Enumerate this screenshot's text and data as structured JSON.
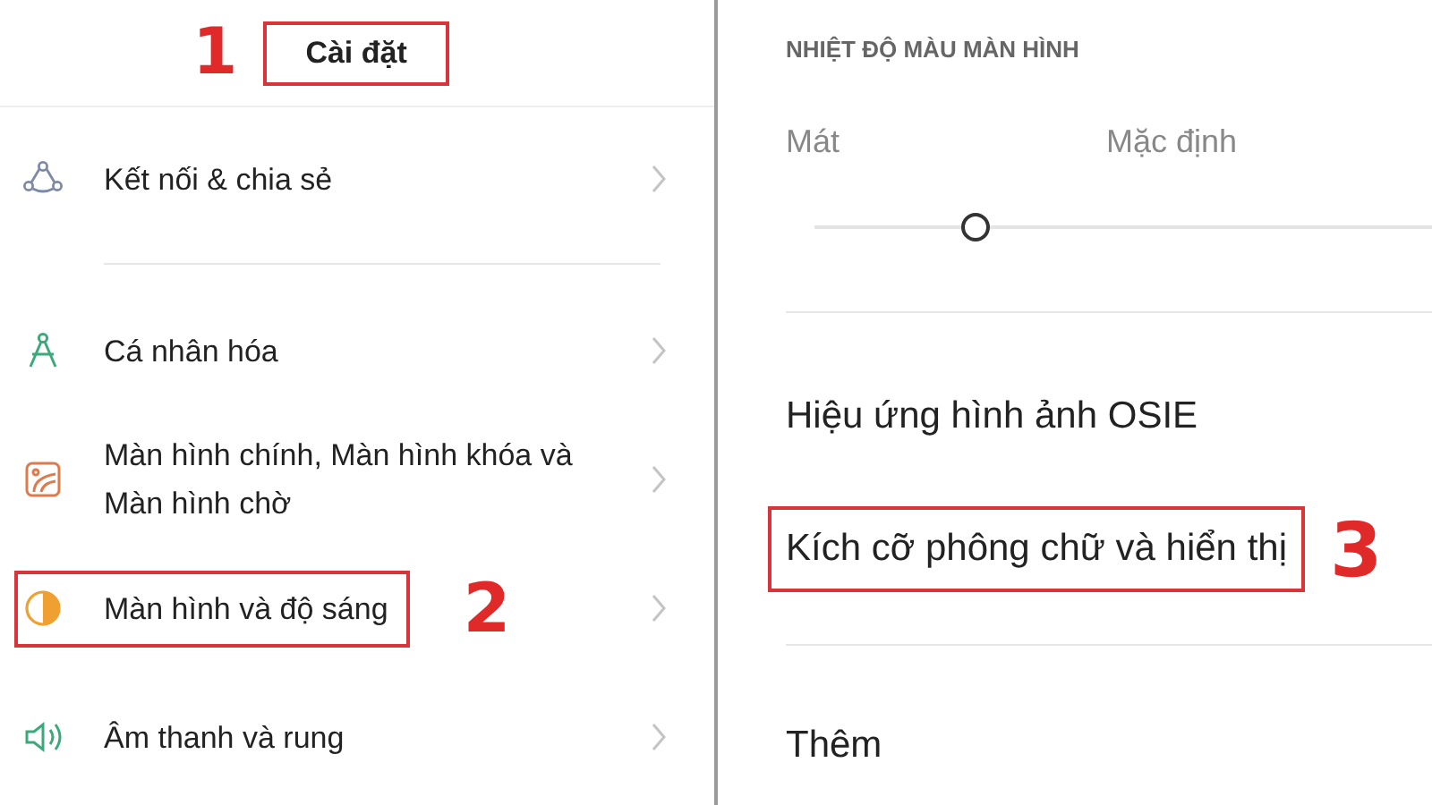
{
  "left_panel": {
    "title": {
      "text": "Cài đặt",
      "highlighted": true,
      "marker": "1"
    },
    "groups": [
      [
        {
          "kind": "share",
          "label": "Kết nối & chia sẻ",
          "highlighted": false
        }
      ],
      [
        {
          "kind": "personalize",
          "label": "Cá nhân hóa",
          "highlighted": false
        },
        {
          "kind": "wallpaper",
          "label": "Màn hình chính, Màn hình khóa và Màn hình chờ",
          "highlighted": false
        },
        {
          "kind": "display",
          "label": "Màn hình và độ sáng",
          "highlighted": true,
          "marker": "2"
        },
        {
          "kind": "sound",
          "label": "Âm thanh và rung",
          "highlighted": false
        }
      ]
    ]
  },
  "right_panel": {
    "items": [
      {
        "kind": "heading",
        "label": "NHIỆT ĐỘ MÀU MÀN HÌNH"
      },
      {
        "kind": "slider",
        "min_label": "Mát",
        "mid_label": "Mặc định",
        "level": 0.26
      },
      {
        "kind": "row",
        "label": "Hiệu ứng hình ảnh OSIE",
        "highlighted": false
      },
      {
        "kind": "row",
        "label": "Kích cỡ phông chữ và hiển thị",
        "highlighted": true,
        "marker": "3"
      },
      {
        "kind": "row",
        "label": "Thêm",
        "highlighted": false
      }
    ]
  }
}
